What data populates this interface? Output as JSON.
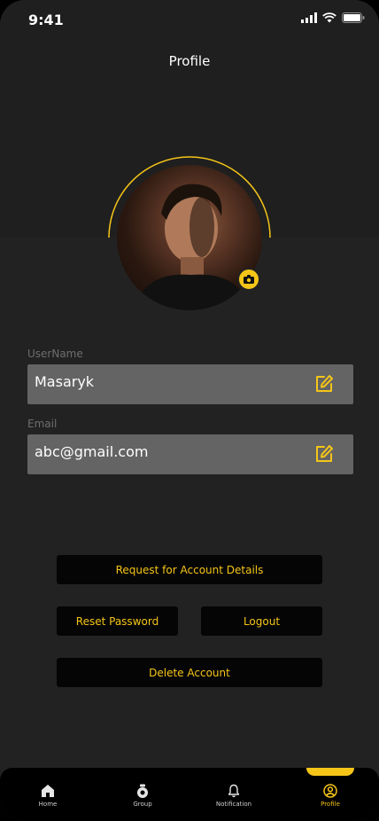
{
  "status": {
    "time": "9:41"
  },
  "header": {
    "title": "Profile"
  },
  "profile": {
    "username_label": "UserName",
    "username_value": "Masaryk",
    "email_label": "Email",
    "email_value": "abc@gmail.com"
  },
  "actions": {
    "request_details": "Request for Account Details",
    "reset_password": "Reset Password",
    "logout": "Logout",
    "delete_account": "Delete Account"
  },
  "nav": {
    "items": [
      {
        "label": "Home",
        "icon": "home-icon"
      },
      {
        "label": "Group",
        "icon": "group-icon"
      },
      {
        "label": "Notification",
        "icon": "bell-icon"
      },
      {
        "label": "Profile",
        "icon": "profile-icon",
        "active": true
      }
    ]
  },
  "colors": {
    "accent": "#f5c518",
    "background": "#222222",
    "field": "#646464",
    "button": "#050505"
  }
}
